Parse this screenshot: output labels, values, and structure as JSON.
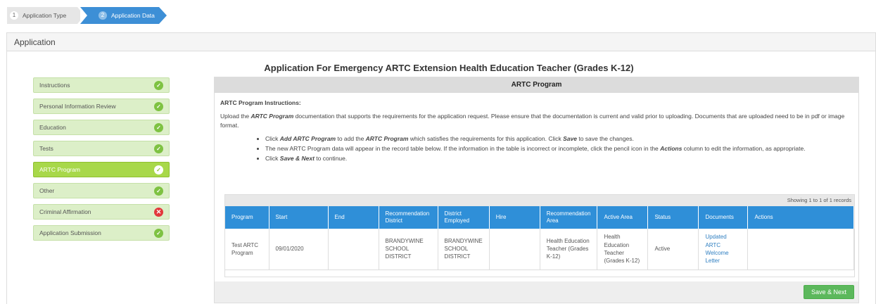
{
  "wizard": {
    "steps": [
      {
        "number": "1",
        "label": "Application Type"
      },
      {
        "number": "2",
        "label": "Application Data"
      }
    ]
  },
  "frame": {
    "title": "Application"
  },
  "app_title": "Application For Emergency ARTC Extension Health Education Teacher (Grades K-12)",
  "sidebar": {
    "items": [
      {
        "label": "Instructions",
        "status": "complete"
      },
      {
        "label": "Personal Information Review",
        "status": "complete"
      },
      {
        "label": "Education",
        "status": "complete"
      },
      {
        "label": "Tests",
        "status": "complete"
      },
      {
        "label": "ARTC Program",
        "status": "complete"
      },
      {
        "label": "Other",
        "status": "complete"
      },
      {
        "label": "Criminal Affirmation",
        "status": "error"
      },
      {
        "label": "Application Submission",
        "status": "complete"
      }
    ],
    "status_icons": {
      "complete": "✓",
      "error": "✕"
    }
  },
  "panel": {
    "title": "ARTC Program",
    "instructions_title": "ARTC Program Instructions:",
    "intro_1": "Upload the ",
    "intro_em": "ARTC Program",
    "intro_2": " documentation that supports the requirements for the application request. Please ensure that the documentation is current and valid prior to uploading. Documents that are uploaded need to be in pdf or image format.",
    "bullet1_a": "Click ",
    "bullet1_b": "Add ARTC Program",
    "bullet1_c": " to add the ",
    "bullet1_d": "ARTC Program",
    "bullet1_e": " which satisfies the requirements for this application. Click ",
    "bullet1_f": "Save",
    "bullet1_g": " to save the changes.",
    "bullet2_a": "The new ARTC Program data will appear in the record table below. If the information in the table is incorrect or incomplete, click the pencil icon in the ",
    "bullet2_b": "Actions",
    "bullet2_c": " column to edit the information, as appropriate.",
    "bullet3_a": "Click ",
    "bullet3_b": "Save & Next",
    "bullet3_c": " to continue."
  },
  "table": {
    "showing": "Showing 1 to 1 of 1 records",
    "headers": [
      "Program",
      "Start",
      "End",
      "Recommendation District",
      "District Employed",
      "Hire",
      "Recommendation Area",
      "Active Area",
      "Status",
      "Documents",
      "Actions"
    ],
    "row": {
      "program": "Test ARTC Program",
      "start": "09/01/2020",
      "end": "",
      "rec_district": "BRANDYWINE SCHOOL DISTRICT",
      "district_employed": "BRANDYWINE SCHOOL DISTRICT",
      "hire": "",
      "rec_area": "Health Education Teacher (Grades K-12)",
      "active_area": "Health Education Teacher (Grades K-12)",
      "status": "Active",
      "documents": "Updated ARTC Welcome Letter",
      "actions": ""
    }
  },
  "buttons": {
    "save_next": "Save & Next"
  },
  "colors": {
    "accent": "#3d8fd6",
    "table_header": "#2f8fd8",
    "active_item": "#a8d84a",
    "success": "#5cb85c",
    "error": "#e2383c"
  }
}
